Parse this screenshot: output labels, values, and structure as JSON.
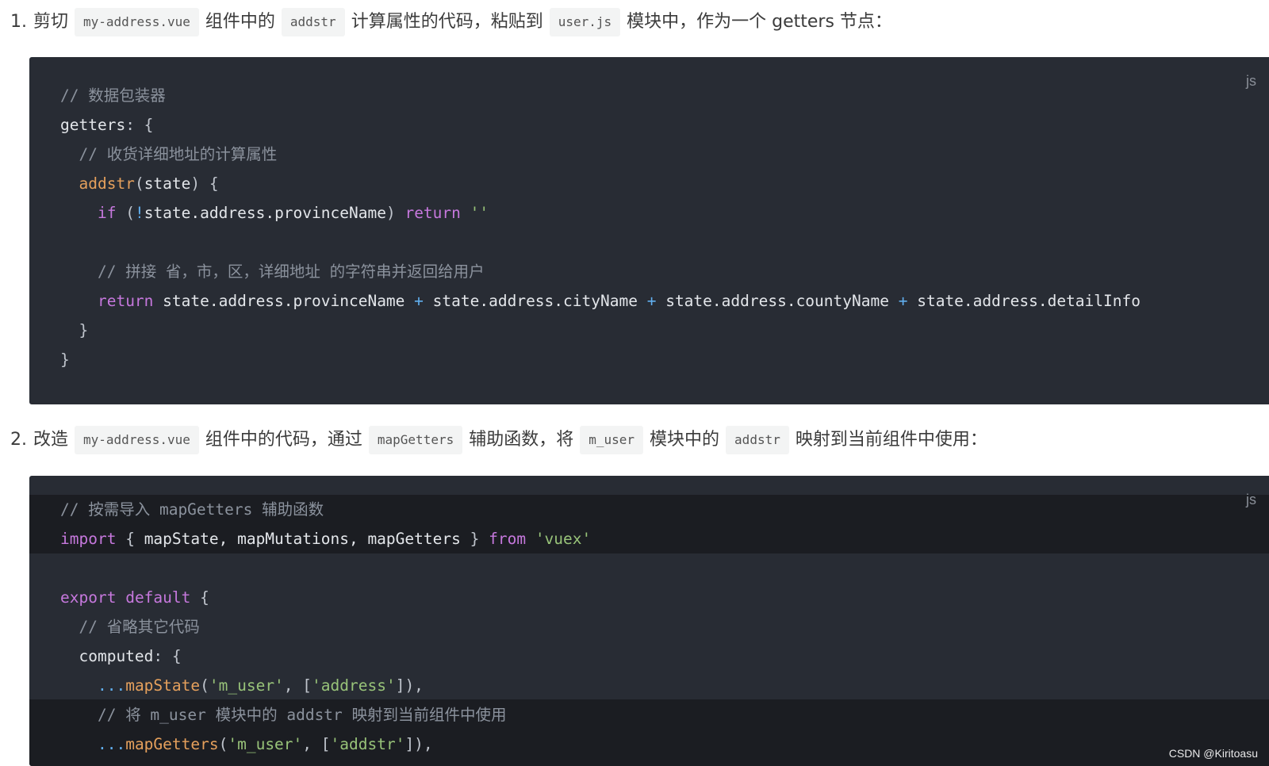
{
  "steps": [
    {
      "num": "1.",
      "parts": {
        "p1": "剪切",
        "c1": "my-address.vue",
        "p2": "组件中的",
        "c2": "addstr",
        "p3": "计算属性的代码，粘贴到",
        "c3": "user.js",
        "p4": "模块中，作为一个 getters 节点："
      }
    },
    {
      "num": "2.",
      "parts": {
        "p1": "改造",
        "c1": "my-address.vue",
        "p2": "组件中的代码，通过",
        "c2": "mapGetters",
        "p3": "辅助函数，将",
        "c3": "m_user",
        "p4": "模块中的",
        "c4": "addstr",
        "p5": "映射到当前组件中使用："
      }
    }
  ],
  "code_blocks": [
    {
      "lang": "js",
      "tokens": {
        "comment1": "// 数据包装器",
        "getters_key": "getters",
        "comment2": "// 收货详细地址的计算属性",
        "fn_name": "addstr",
        "param": "state",
        "kw_if": "if",
        "cond": "state.address.provinceName",
        "kw_return1": "return",
        "empty_str": "''",
        "comment3": "// 拼接 省，市，区，详细地址 的字符串并返回给用户",
        "kw_return2": "return",
        "expr1": "state.address.provinceName",
        "expr2": "state.address.cityName",
        "expr3": "state.address.countyName",
        "expr4": "state.address.detailInfo"
      }
    },
    {
      "lang": "js",
      "tokens": {
        "comment1": "// 按需导入 mapGetters 辅助函数",
        "kw_import": "import",
        "imports": "mapState, mapMutations, mapGetters",
        "kw_from": "from",
        "module": "'vuex'",
        "kw_export": "export",
        "kw_default": "default",
        "comment2": "// 省略其它代码",
        "computed_key": "computed",
        "fn_mapState": "mapState",
        "arg_m_user1": "'m_user'",
        "arg_address": "'address'",
        "comment3": "// 将 m_user 模块中的 addstr 映射到当前组件中使用",
        "fn_mapGetters": "mapGetters",
        "arg_m_user2": "'m_user'",
        "arg_addstr": "'addstr'"
      }
    }
  ],
  "watermark": "CSDN @Kiritoasu"
}
